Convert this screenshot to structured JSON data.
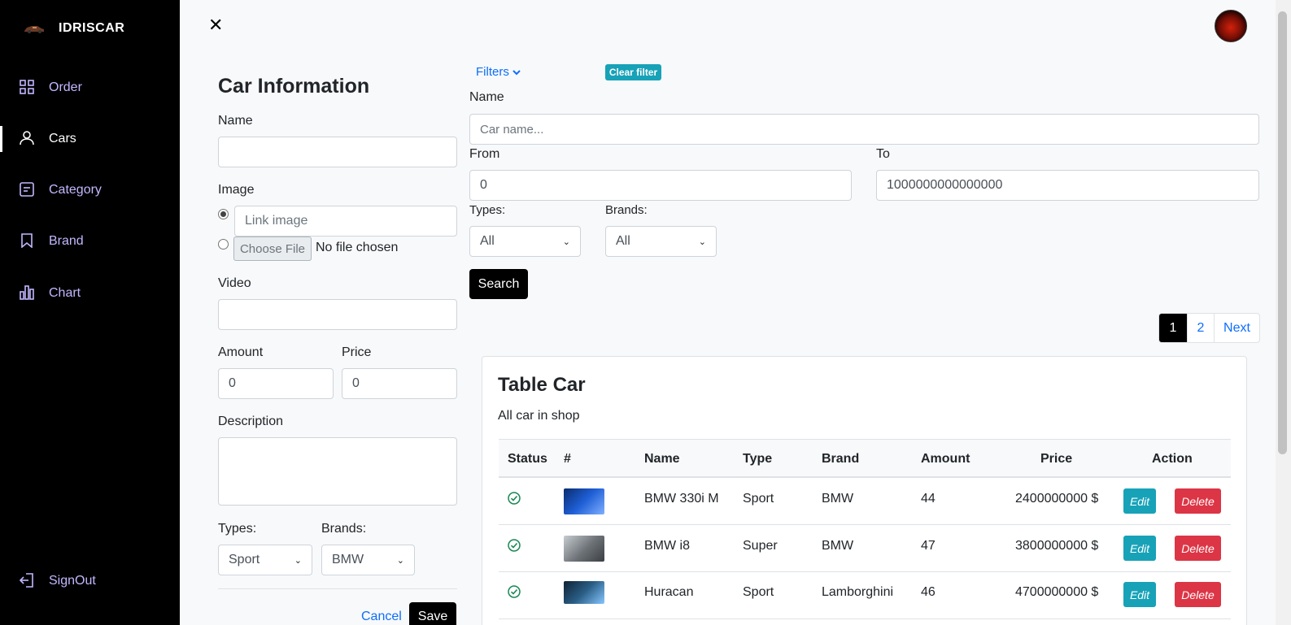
{
  "app": {
    "name": "IDRISCAR"
  },
  "sidebar": {
    "items": [
      {
        "label": "Order",
        "icon": "grid-icon"
      },
      {
        "label": "Cars",
        "icon": "user-icon"
      },
      {
        "label": "Category",
        "icon": "document-icon"
      },
      {
        "label": "Brand",
        "icon": "bookmark-icon"
      },
      {
        "label": "Chart",
        "icon": "bar-chart-icon"
      }
    ],
    "signout": "SignOut"
  },
  "form": {
    "title": "Car Information",
    "name_label": "Name",
    "name_value": "",
    "image_label": "Image",
    "image_link_placeholder": "Link image",
    "choose_file": "Choose File",
    "no_file": "No file chosen",
    "video_label": "Video",
    "video_value": "",
    "amount_label": "Amount",
    "amount_value": "0",
    "price_label": "Price",
    "price_value": "0",
    "description_label": "Description",
    "types_label": "Types:",
    "types_value": "Sport",
    "brands_label": "Brands:",
    "brands_value": "BMW",
    "cancel": "Cancel",
    "save": "Save"
  },
  "filters": {
    "toggle": "Filters",
    "clear": "Clear filter",
    "name_label": "Name",
    "name_placeholder": "Car name...",
    "from_label": "From",
    "from_value": "0",
    "to_label": "To",
    "to_value": "1000000000000000",
    "types_label": "Types:",
    "types_value": "All",
    "brands_label": "Brands:",
    "brands_value": "All",
    "search": "Search"
  },
  "pagination": {
    "pages": [
      "1",
      "2"
    ],
    "next": "Next",
    "active": "1"
  },
  "table": {
    "title": "Table Car",
    "subtitle": "All car in shop",
    "headers": [
      "Status",
      "#",
      "Name",
      "Type",
      "Brand",
      "Amount",
      "Price",
      "Action"
    ],
    "rows": [
      {
        "name": "BMW 330i M",
        "type": "Sport",
        "brand": "BMW",
        "amount": "44",
        "price": "2400000000 $",
        "thumb_color": "#1f5fd6"
      },
      {
        "name": "BMW i8",
        "type": "Super",
        "brand": "BMW",
        "amount": "47",
        "price": "3800000000 $",
        "thumb_color": "#8a8f94"
      },
      {
        "name": "Huracan",
        "type": "Sport",
        "brand": "Lamborghini",
        "amount": "46",
        "price": "4700000000 $",
        "thumb_color": "#2a5e86"
      }
    ],
    "edit": "Edit",
    "delete": "Delete"
  },
  "colors": {
    "accent": "#17a2b8",
    "danger": "#dc3545",
    "success": "#198754",
    "link": "#0d6efd",
    "sidebar_text": "#c3b7ff"
  }
}
